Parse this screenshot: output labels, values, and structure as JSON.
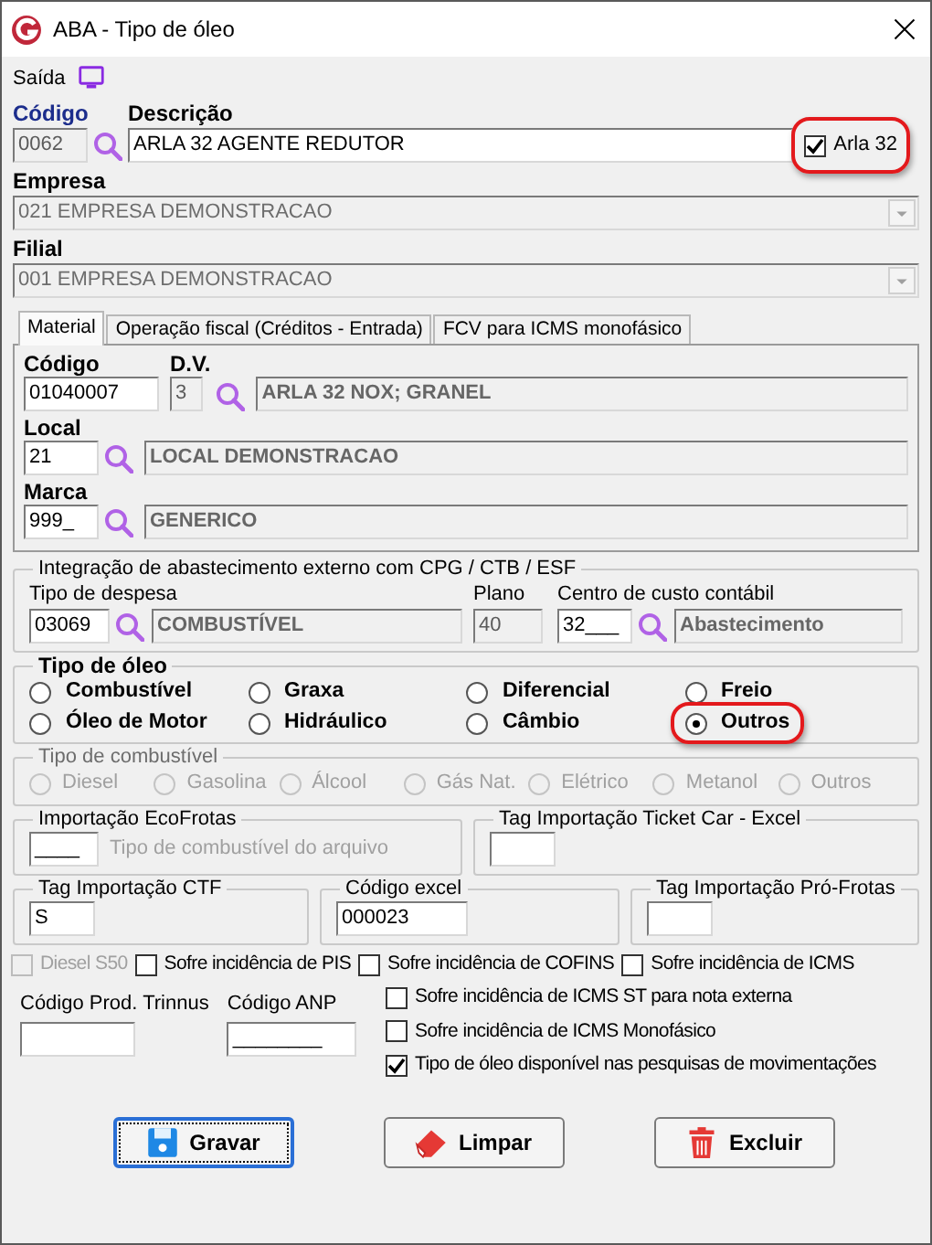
{
  "window": {
    "title": "ABA - Tipo de óleo"
  },
  "menu": [
    {
      "label": "Saída"
    }
  ],
  "codigo": {
    "label": "Código",
    "value": "0062"
  },
  "descricao": {
    "label": "Descrição",
    "value": "ARLA 32 AGENTE REDUTOR"
  },
  "arla_32": {
    "label": "Arla 32",
    "checked": true,
    "highlighted": true
  },
  "empresa": {
    "label": "Empresa",
    "value": "021 EMPRESA DEMONSTRACAO",
    "disabled": true
  },
  "filial": {
    "label": "Filial",
    "value": "001 EMPRESA DEMONSTRACAO",
    "disabled": true
  },
  "tabs": [
    {
      "label": "Material",
      "selected": true
    },
    {
      "label": "Operação fiscal (Créditos - Entrada)",
      "selected": false
    },
    {
      "label": "FCV para ICMS monofásico",
      "selected": false
    }
  ],
  "material": {
    "codigo": {
      "label": "Código",
      "value": "01040007"
    },
    "dv": {
      "label": "D.V.",
      "value": "3"
    },
    "descricao": "ARLA 32 NOX; GRANEL",
    "local": {
      "label": "Local",
      "value": "21",
      "descricao": "LOCAL DEMONSTRACAO"
    },
    "marca": {
      "label": "Marca",
      "value": "999_",
      "descricao": "GENERICO"
    }
  },
  "integracao": {
    "title": "Integração de abastecimento externo com CPG / CTB / ESF",
    "tipo_despesa": {
      "label": "Tipo de despesa",
      "value": "03069",
      "descricao": "COMBUSTÍVEL"
    },
    "plano": {
      "label": "Plano",
      "value": "40"
    },
    "centro_custo": {
      "label": "Centro de custo contábil",
      "value": "32___",
      "descricao": "Abastecimento"
    }
  },
  "tipo_oleo": {
    "title": "Tipo de óleo",
    "options": [
      {
        "label": "Combustível",
        "selected": false,
        "highlighted": false
      },
      {
        "label": "Graxa",
        "selected": false,
        "highlighted": false
      },
      {
        "label": "Diferencial",
        "selected": false,
        "highlighted": false
      },
      {
        "label": "Freio",
        "selected": false,
        "highlighted": false
      },
      {
        "label": "Óleo de Motor",
        "selected": false,
        "highlighted": false
      },
      {
        "label": "Hidráulico",
        "selected": false,
        "highlighted": false
      },
      {
        "label": "Câmbio",
        "selected": false,
        "highlighted": false
      },
      {
        "label": "Outros",
        "selected": true,
        "highlighted": true
      }
    ]
  },
  "tipo_combustivel": {
    "title": "Tipo de combustível",
    "disabled": true,
    "options": [
      {
        "label": "Diesel",
        "selected": false
      },
      {
        "label": "Gasolina",
        "selected": false
      },
      {
        "label": "Álcool",
        "selected": false
      },
      {
        "label": "Gás Nat.",
        "selected": false
      },
      {
        "label": "Elétrico",
        "selected": false
      },
      {
        "label": "Metanol",
        "selected": false
      },
      {
        "label": "Outros",
        "selected": false
      }
    ]
  },
  "ecofrotas": {
    "title": "Importação EcoFrotas",
    "value": "____",
    "hint": "Tipo de combustível do arquivo"
  },
  "ticket_car": {
    "title": "Tag Importação Ticket Car - Excel"
  },
  "ctf": {
    "title": "Tag Importação CTF",
    "value": "S"
  },
  "codigo_excel": {
    "title": "Código excel",
    "value": "000023"
  },
  "pro_frotas": {
    "title": "Tag Importação Pró-Frotas"
  },
  "checkbox_row": [
    {
      "label": "Diesel S50",
      "checked": false,
      "disabled": true
    },
    {
      "label": "Sofre incidência de PIS",
      "checked": false,
      "disabled": false
    },
    {
      "label": "Sofre incidência de COFINS",
      "checked": false,
      "disabled": false
    },
    {
      "label": "Sofre incidência de ICMS",
      "checked": false,
      "disabled": false
    }
  ],
  "codigo_trinnus": {
    "label": "Código Prod. Trinnus"
  },
  "codigo_anp": {
    "label": "Código ANP",
    "value": "________"
  },
  "right_checkboxes": [
    {
      "label": "Sofre incidência de ICMS ST para nota externa",
      "checked": false
    },
    {
      "label": "Sofre incidência de ICMS Monofásico",
      "checked": false
    },
    {
      "label": "Tipo de óleo disponível nas pesquisas de movimentações",
      "checked": true
    }
  ],
  "buttons": [
    {
      "label": "Gravar",
      "kind": "save",
      "focused": true
    },
    {
      "label": "Limpar",
      "kind": "clear",
      "focused": false
    },
    {
      "label": "Excluir",
      "kind": "delete",
      "focused": false
    }
  ]
}
